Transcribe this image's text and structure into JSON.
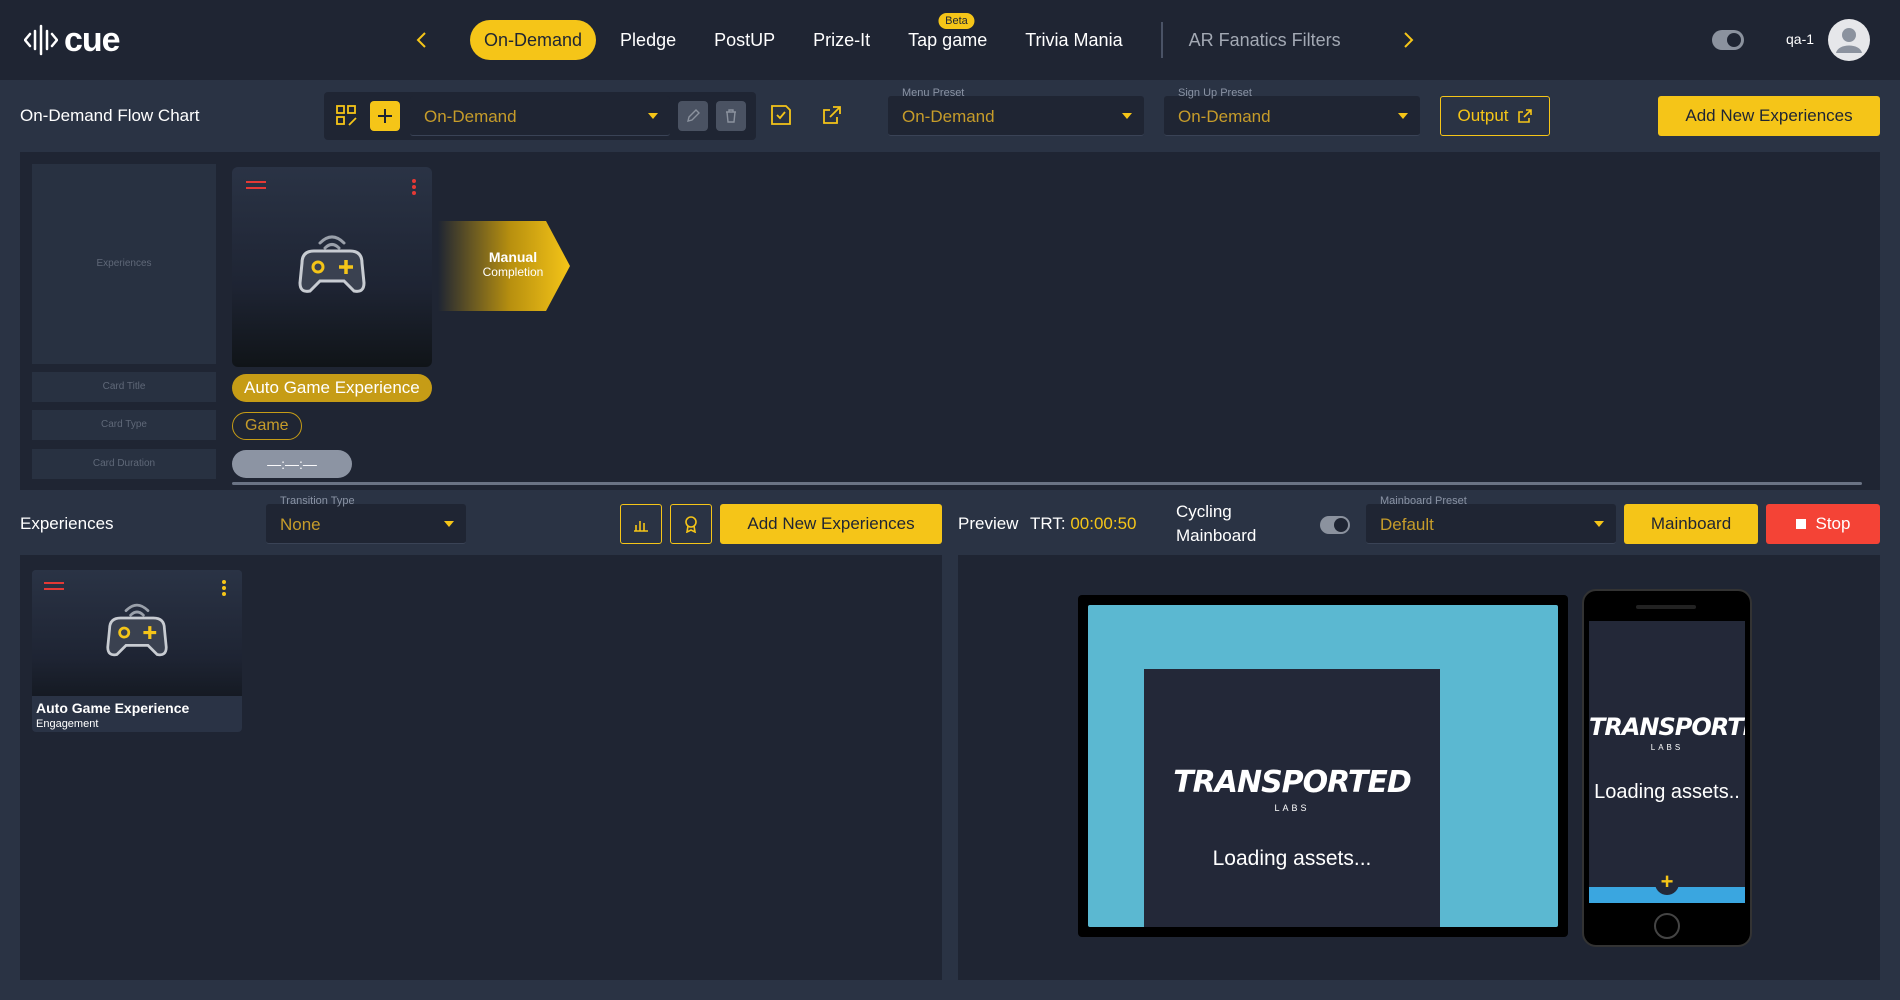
{
  "app": {
    "logo_text": "cue",
    "user_name": "qa-1"
  },
  "nav": {
    "tabs": [
      {
        "label": "On-Demand"
      },
      {
        "label": "Pledge"
      },
      {
        "label": "PostUP"
      },
      {
        "label": "Prize-It"
      },
      {
        "label": "Tap game",
        "badge": "Beta"
      },
      {
        "label": "Trivia Mania"
      },
      {
        "label": "AR Fanatics Filters"
      }
    ]
  },
  "flow_header": {
    "title": "On-Demand Flow Chart",
    "flow_select_value": "On-Demand",
    "menu_preset_label": "Menu Preset",
    "menu_preset_value": "On-Demand",
    "signup_preset_label": "Sign Up Preset",
    "signup_preset_value": "On-Demand",
    "output_label": "Output",
    "add_new_label": "Add New Experiences"
  },
  "flow_chart": {
    "legend": {
      "experiences": "Experiences",
      "card_title": "Card Title",
      "card_type": "Card Type",
      "card_duration": "Card Duration"
    },
    "card": {
      "title": "Auto Game Experience",
      "type": "Game",
      "duration": "—:—:—"
    },
    "transition": {
      "line1": "Manual",
      "line2": "Completion"
    }
  },
  "experiences_bar": {
    "title": "Experiences",
    "transition_type_label": "Transition Type",
    "transition_type_value": "None",
    "add_new_label": "Add New Experiences",
    "preview_label": "Preview",
    "trt_label": "TRT:",
    "trt_value": "00:00:50",
    "cycling_line1": "Cycling",
    "cycling_line2": "Mainboard",
    "mainboard_preset_label": "Mainboard Preset",
    "mainboard_preset_value": "Default",
    "mainboard_label": "Mainboard",
    "stop_label": "Stop"
  },
  "experiences_list": [
    {
      "title": "Auto Game Experience",
      "subtitle": "Engagement"
    }
  ],
  "preview": {
    "brand_title": "TRANSPORTED",
    "brand_sub": "LABS",
    "tv_loading": "Loading assets...",
    "phone_loading": "Loading assets..",
    "phone_plus": "+"
  },
  "colors": {
    "accent": "#f5c518",
    "background": "#2a3344",
    "panel": "#1f2533",
    "danger": "#f44336"
  }
}
